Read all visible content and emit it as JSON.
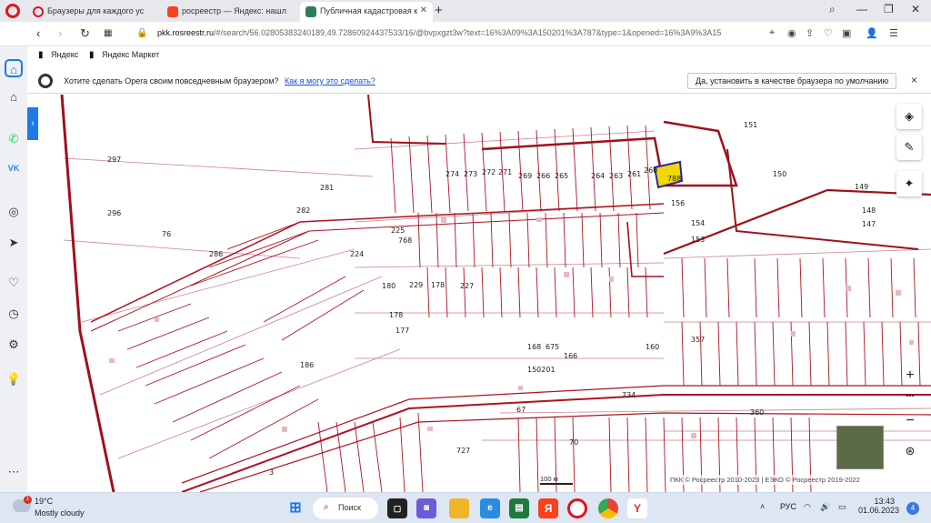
{
  "browser": {
    "tabs": [
      {
        "title": "Браузеры для каждого ус",
        "icon": "opera-icon",
        "active": false
      },
      {
        "title": "росреестр — Яндекс: нашл",
        "icon": "yandex-icon",
        "active": false
      },
      {
        "title": "Публичная кадастровая к",
        "icon": "rosreestr-icon",
        "active": true
      }
    ],
    "new_tab": "+",
    "url_host": "pkk.rosreestr.ru",
    "url_path": "/#/search/56.02805383240189,49.72860924437533/16/@bvpxgzt3w?text=16%3A09%3A150201%3A787&type=1&opened=16%3A9%3A15"
  },
  "bookmarks": [
    {
      "label": "Яндекс",
      "icon": "yandex-icon"
    },
    {
      "label": "Яндекс Маркет",
      "icon": "yandex-market-icon"
    }
  ],
  "infobar": {
    "message": "Хотите сделать Opera своим повседневным браузером?",
    "link": "Как я могу это сделать?",
    "button": "Да, установить в качестве браузера по умолчанию",
    "close": "×"
  },
  "map": {
    "copyright": "ПКК © Росреестр 2010-2023 | ЕЭКО © Росреестр 2019-2022",
    "scale": "100 м",
    "controls": {
      "zoom_in": "+",
      "more": "•••",
      "zoom_out": "−"
    },
    "accent_color": "#a0101a"
  },
  "taskbar": {
    "weather_temp": "19°C",
    "weather_desc": "Mostly cloudy",
    "weather_badge": "1",
    "search_label": "Поиск",
    "lang": "РУС",
    "time": "13:43",
    "date": "01.06.2023",
    "notifications": "4"
  }
}
